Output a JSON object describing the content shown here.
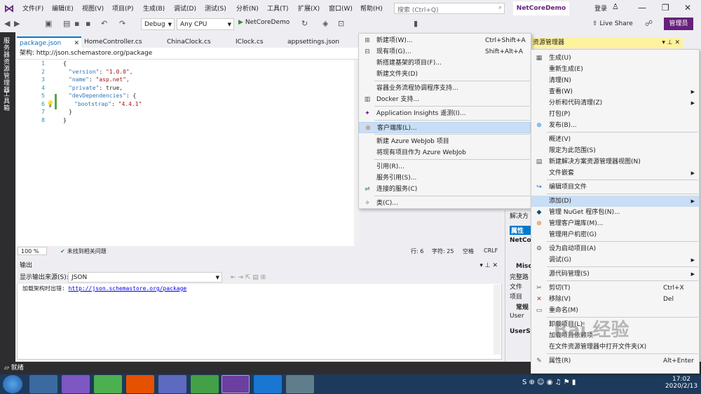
{
  "menubar": {
    "items": [
      "文件(F)",
      "编辑(E)",
      "视图(V)",
      "项目(P)",
      "生成(B)",
      "调试(D)",
      "测试(S)",
      "分析(N)",
      "工具(T)",
      "扩展(X)",
      "窗口(W)",
      "帮助(H)"
    ],
    "search_placeholder": "搜索 (Ctrl+Q)",
    "project_name": "NetCoreDemo",
    "login": "登录"
  },
  "toolbar": {
    "config": "Debug",
    "platform": "Any CPU",
    "run": "NetCoreDemo",
    "live_share": "Live Share",
    "admin": "管理员"
  },
  "leftrail": {
    "items": [
      "服务器资源管理器",
      "工具箱"
    ]
  },
  "tabs": [
    "package.json",
    "HomeController.cs",
    "ChinaClock.cs",
    "IClock.cs",
    "appsettings.json"
  ],
  "editor": {
    "schema_label": "架构:",
    "schema_url": "http://json.schemastore.org/package",
    "lines": [
      {
        "n": "1",
        "text": "{"
      },
      {
        "n": "2",
        "key": "\"version\"",
        "val": "\"1.0.0\","
      },
      {
        "n": "3",
        "key": "\"name\"",
        "val": "\"asp.net\","
      },
      {
        "n": "4",
        "key": "\"private\"",
        "val": "true,"
      },
      {
        "n": "5",
        "key": "\"devDependencies\"",
        "val": "{"
      },
      {
        "n": "6",
        "key": "\"bootstrap\"",
        "val": "\"4.4.1\""
      },
      {
        "n": "7",
        "text": "}"
      },
      {
        "n": "8",
        "text": "}"
      }
    ],
    "zoom": "100 %",
    "issues": "未找到相关问题",
    "row": "行: 6",
    "col": "字符: 25",
    "ws": "空格",
    "eol": "CRLF"
  },
  "output": {
    "title": "输出",
    "source_label": "显示输出来源(S):",
    "source": "JSON",
    "message": "加载架构时出错:",
    "url": "http://json.schemastore.org/package"
  },
  "solution_explorer": {
    "title": "资源管理器"
  },
  "properties": {
    "labels": [
      "解决方",
      "属性",
      "NetCor",
      "Misc",
      "完整路",
      "文件",
      "项目",
      "常规",
      "User",
      "UserSe"
    ]
  },
  "add_submenu": [
    {
      "icon": "new-item-icon",
      "label": "新建项(W)...",
      "shortcut": "Ctrl+Shift+A"
    },
    {
      "icon": "existing-item-icon",
      "label": "现有项(G)...",
      "shortcut": "Shift+Alt+A"
    },
    {
      "icon": "",
      "label": "新搭建基架的项目(F)...",
      "shortcut": ""
    },
    {
      "icon": "",
      "label": "新建文件夹(D)",
      "shortcut": ""
    },
    {
      "sep": true
    },
    {
      "icon": "",
      "label": "容器业务流程协调程序支持...",
      "shortcut": ""
    },
    {
      "icon": "docker-icon",
      "label": "Docker 支持...",
      "shortcut": ""
    },
    {
      "sep": true
    },
    {
      "icon": "insights-icon",
      "label": "Application Insights 遥测(I)...",
      "shortcut": ""
    },
    {
      "sep": true
    },
    {
      "icon": "client-lib-icon",
      "label": "客户端库(L)...",
      "shortcut": "",
      "hl": true
    },
    {
      "sep": true
    },
    {
      "icon": "",
      "label": "新建 Azure WebJob 项目",
      "shortcut": ""
    },
    {
      "icon": "",
      "label": "将现有项目作为 Azure WebJob",
      "shortcut": ""
    },
    {
      "sep": true
    },
    {
      "icon": "",
      "label": "引用(R)...",
      "shortcut": ""
    },
    {
      "icon": "",
      "label": "服务引用(S)...",
      "shortcut": ""
    },
    {
      "icon": "connected-service-icon",
      "label": "连接的服务(C)",
      "shortcut": ""
    },
    {
      "sep": true
    },
    {
      "icon": "class-icon",
      "label": "类(C)...",
      "shortcut": ""
    }
  ],
  "context_menu": [
    {
      "icon": "build-icon",
      "label": "生成(U)"
    },
    {
      "icon": "",
      "label": "重新生成(E)"
    },
    {
      "icon": "",
      "label": "清理(N)"
    },
    {
      "icon": "",
      "label": "查看(W)",
      "arrow": true
    },
    {
      "icon": "",
      "label": "分析和代码清理(Z)",
      "arrow": true
    },
    {
      "icon": "",
      "label": "打包(P)"
    },
    {
      "icon": "publish-icon",
      "label": "发布(B)..."
    },
    {
      "sep": true
    },
    {
      "icon": "",
      "label": "概述(V)"
    },
    {
      "icon": "",
      "label": "限定为此范围(S)"
    },
    {
      "icon": "new-view-icon",
      "label": "新建解决方案资源管理器视图(N)"
    },
    {
      "icon": "",
      "label": "文件嵌套",
      "arrow": true
    },
    {
      "sep": true
    },
    {
      "icon": "edit-project-icon",
      "label": "编辑项目文件"
    },
    {
      "sep": true
    },
    {
      "icon": "",
      "label": "添加(D)",
      "arrow": true,
      "hl": true
    },
    {
      "icon": "nuget-icon",
      "label": "管理 NuGet 程序包(N)..."
    },
    {
      "icon": "client-lib-icon",
      "label": "管理客户端库(M)..."
    },
    {
      "icon": "",
      "label": "管理用户机密(G)"
    },
    {
      "sep": true
    },
    {
      "icon": "gear-icon",
      "label": "设为启动项目(A)"
    },
    {
      "icon": "",
      "label": "调试(G)",
      "arrow": true
    },
    {
      "sep": true
    },
    {
      "icon": "",
      "label": "源代码管理(S)",
      "arrow": true
    },
    {
      "sep": true
    },
    {
      "icon": "cut-icon",
      "label": "剪切(T)",
      "shortcut": "Ctrl+X"
    },
    {
      "icon": "remove-icon",
      "label": "移除(V)",
      "shortcut": "Del"
    },
    {
      "icon": "rename-icon",
      "label": "重命名(M)"
    },
    {
      "sep": true
    },
    {
      "icon": "",
      "label": "卸载项目(L)"
    },
    {
      "icon": "",
      "label": "加载项目依赖项"
    },
    {
      "icon": "",
      "label": "在文件资源管理器中打开文件夹(X)"
    },
    {
      "sep": true
    },
    {
      "icon": "wrench-icon",
      "label": "属性(R)",
      "shortcut": "Alt+Enter"
    }
  ],
  "bottombar": {
    "ready": "就绪"
  },
  "clock": {
    "time": "17:02",
    "date": "2020/2/13"
  },
  "colors": {
    "accent": "#68217a",
    "highlight": "#c9def5",
    "se_header": "#fff29d"
  }
}
